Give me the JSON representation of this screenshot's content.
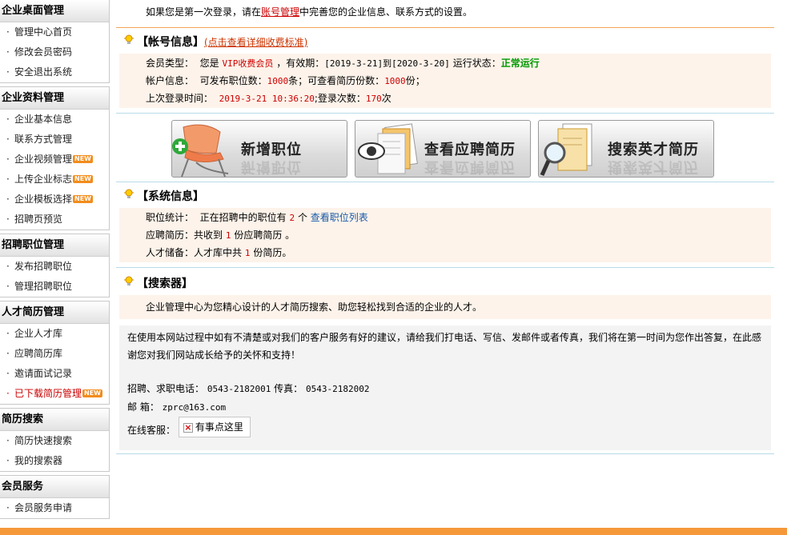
{
  "sidebar": {
    "groups": [
      {
        "title": "企业桌面管理",
        "items": [
          {
            "label": "管理中心首页"
          },
          {
            "label": "修改会员密码"
          },
          {
            "label": "安全退出系统"
          }
        ]
      },
      {
        "title": "企业资料管理",
        "items": [
          {
            "label": "企业基本信息"
          },
          {
            "label": "联系方式管理"
          },
          {
            "label": "企业视频管理",
            "badge": "NEW"
          },
          {
            "label": "上传企业标志",
            "badge": "NEW"
          },
          {
            "label": "企业模板选择",
            "badge": "NEW"
          },
          {
            "label": "招聘页预览"
          }
        ]
      },
      {
        "title": "招聘职位管理",
        "items": [
          {
            "label": "发布招聘职位"
          },
          {
            "label": "管理招聘职位"
          }
        ]
      },
      {
        "title": "人才简历管理",
        "items": [
          {
            "label": "企业人才库"
          },
          {
            "label": "应聘简历库"
          },
          {
            "label": "邀请面试记录"
          },
          {
            "label": "已下载简历管理",
            "badge": "NEW",
            "highlight": true
          }
        ]
      },
      {
        "title": "简历搜索",
        "items": [
          {
            "label": "简历快速搜索"
          },
          {
            "label": "我的搜索器"
          }
        ]
      },
      {
        "title": "会员服务",
        "items": [
          {
            "label": "会员服务申请"
          }
        ]
      }
    ],
    "bullet": "·"
  },
  "notice": {
    "prefix": "如果您是第一次登录，请在",
    "link": "账号管理",
    "suffix": "中完善您的企业信息、联系方式的设置。"
  },
  "account": {
    "title": "【帐号信息】",
    "detail_link": "(点击查看详细收费标准)",
    "member_type_label": "会员类型：",
    "member_type_pre": "您是",
    "member_type": "VIP收费会员",
    "validity_label": "，有效期：",
    "validity": "[2019-3-21]到[2020-3-20]",
    "status_label": "运行状态：",
    "status": "正常运行",
    "account_label": "帐户信息：",
    "jobs_label": "可发布职位数：",
    "jobs": "1000",
    "jobs_unit": "条；可查看简历份数：",
    "resumes": "1000",
    "resumes_unit": "份；",
    "last_login_label": "上次登录时间：",
    "last_login": "2019-3-21 10:36:20",
    "login_count_label": ";登录次数：",
    "login_count": "170",
    "login_count_unit": "次"
  },
  "big_buttons": [
    {
      "label": "新增职位"
    },
    {
      "label": "查看应聘简历"
    },
    {
      "label": "搜索英才简历"
    }
  ],
  "system": {
    "title": "【系统信息】",
    "jobs_label": "职位统计：",
    "jobs_pre": "正在招聘中的职位有",
    "jobs_count": "2",
    "jobs_unit": "个",
    "jobs_link": "查看职位列表",
    "resumes_label": "应聘简历：",
    "resumes_pre": "共收到",
    "resumes_count": "1",
    "resumes_unit": "份应聘简历 。",
    "talent_label": "人才储备：",
    "talent_pre": "人才库中共",
    "talent_count": "1",
    "talent_unit": "份简历。"
  },
  "search": {
    "title": "【搜索器】",
    "desc": "企业管理中心为您精心设计的人才简历搜索、助您轻松找到合适的企业的人才。"
  },
  "contact": {
    "line1": "在使用本网站过程中如有不清楚或对我们的客户服务有好的建议，请给我们打电话、写信、发邮件或者传真，我们将在第一时间为您作出答复，在此感",
    "line2": "谢您对我们网站成长给予的关怀和支持！",
    "phone_label": "招聘、求职电话：",
    "phone": "0543-2182001",
    "fax_label": "传真：",
    "fax": "0543-2182002",
    "email_label": "邮 箱：",
    "email": "zprc@163.com",
    "chat_label": "在线客服：",
    "chat_button": "有事点这里"
  },
  "colors": {
    "accent_orange": "#f5983a",
    "status_green": "#009900",
    "value_red": "#cc0000",
    "link_blue": "#1a5aa8"
  }
}
